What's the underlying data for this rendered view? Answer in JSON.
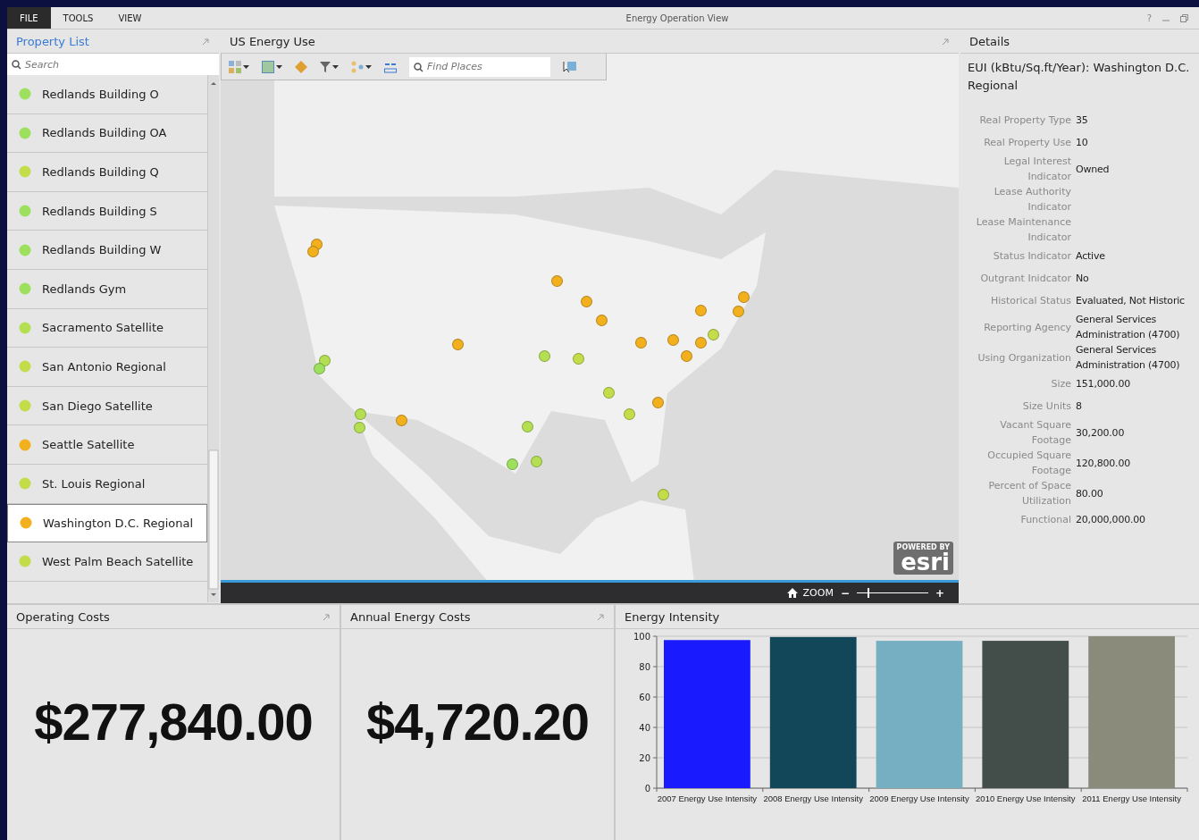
{
  "window": {
    "title": "Energy Operation View",
    "menu": [
      {
        "label": "FILE",
        "selected": true
      },
      {
        "label": "TOOLS",
        "selected": false
      },
      {
        "label": "VIEW",
        "selected": false
      }
    ],
    "help": "?"
  },
  "property_list": {
    "title": "Property List",
    "search": {
      "placeholder": "Search"
    },
    "items": [
      {
        "name": "Redlands Building O",
        "color": "#9de05e",
        "selected": false
      },
      {
        "name": "Redlands Building OA",
        "color": "#9de05e",
        "selected": false
      },
      {
        "name": "Redlands Building Q",
        "color": "#c2dc4a",
        "selected": false
      },
      {
        "name": "Redlands Building S",
        "color": "#9de05e",
        "selected": false
      },
      {
        "name": "Redlands Building W",
        "color": "#9de05e",
        "selected": false
      },
      {
        "name": "Redlands Gym",
        "color": "#9de05e",
        "selected": false
      },
      {
        "name": "Sacramento Satellite",
        "color": "#b4df52",
        "selected": false
      },
      {
        "name": "San Antonio Regional",
        "color": "#c2dc4a",
        "selected": false
      },
      {
        "name": "San Diego Satellite",
        "color": "#c2dc4a",
        "selected": false
      },
      {
        "name": "Seattle Satellite",
        "color": "#f2b01e",
        "selected": false
      },
      {
        "name": "St. Louis Regional",
        "color": "#c2dc4a",
        "selected": false
      },
      {
        "name": "Washington D.C. Regional",
        "color": "#f2b01e",
        "selected": true
      },
      {
        "name": "West Palm Beach Satellite",
        "color": "#c2dc4a",
        "selected": false
      }
    ]
  },
  "map": {
    "title": "US Energy Use",
    "find": {
      "placeholder": "Find Places"
    },
    "markers": [
      {
        "color": "#f2b01e"
      },
      {
        "color": "#f2b01e"
      },
      {
        "color": "#f2b01e"
      },
      {
        "color": "#f2b01e"
      },
      {
        "color": "#f2b01e"
      },
      {
        "color": "#f2b01e"
      },
      {
        "color": "#f2b01e"
      },
      {
        "color": "#f2b01e"
      },
      {
        "color": "#f2b01e"
      },
      {
        "color": "#f2b01e"
      },
      {
        "color": "#f2b01e"
      },
      {
        "color": "#f2b01e"
      },
      {
        "color": "#c2dc4a"
      },
      {
        "color": "#f2b01e"
      },
      {
        "color": "#b4df52"
      },
      {
        "color": "#c2dc4a"
      },
      {
        "color": "#b4df52"
      },
      {
        "color": "#9de05e"
      },
      {
        "color": "#c2dc4a"
      },
      {
        "color": "#f2b01e"
      },
      {
        "color": "#c2dc4a"
      },
      {
        "color": "#b4df52"
      },
      {
        "color": "#b4df52"
      },
      {
        "color": "#f2b01e"
      },
      {
        "color": "#b4df52"
      },
      {
        "color": "#9de05e"
      },
      {
        "color": "#b4df52"
      },
      {
        "color": "#c2dc4a"
      }
    ],
    "logo_caption": "POWERED BY",
    "logo": "esri",
    "zoom": {
      "label": "ZOOM",
      "minus": "−",
      "plus": "+",
      "level": 0.15
    }
  },
  "details": {
    "title": "Details",
    "heading": "EUI (kBtu/Sq.ft/Year): Washington D.C. Regional",
    "rows": [
      {
        "label": "Real Property Type",
        "value": "35"
      },
      {
        "label": "Real Property Use",
        "value": "10"
      },
      {
        "label": "Legal Interest Indicator",
        "value": "Owned"
      },
      {
        "label": "Lease Authority Indicator"
      },
      {
        "label": "Lease Maintenance Indicator"
      },
      {
        "label": "Status Indicator",
        "value": "Active"
      },
      {
        "label": "Outgrant Inidcator",
        "value": "No"
      },
      {
        "label": "Historical Status",
        "value": "Evaluated, Not Historic"
      },
      {
        "label": "Reporting Agency",
        "value": "General Services Administration (4700)"
      },
      {
        "label": "Using Organization",
        "value": "General Services Administration (4700)"
      },
      {
        "label": "Size",
        "value": "151,000.00"
      },
      {
        "label": "Size Units",
        "value": "8"
      },
      {
        "label": "Vacant Square Footage",
        "value": "30,200.00"
      },
      {
        "label": "Occupied Square Footage",
        "value": "120,800.00"
      },
      {
        "label": "Percent of Space Utilization",
        "value": "80.00"
      },
      {
        "label": "Functional",
        "value": "20,000,000.00"
      }
    ]
  },
  "operating_costs": {
    "title": "Operating Costs",
    "value": "$277,840.00"
  },
  "annual_energy_costs": {
    "title": "Annual Energy Costs",
    "value": "$4,720.20"
  },
  "energy_intensity": {
    "title": "Energy Intensity",
    "chart_data": {
      "type": "bar",
      "series": [
        {
          "name": "2007 Energy Use Intensity",
          "color": "#1a1aff",
          "values": [
            97.5
          ]
        },
        {
          "name": "2008 Energy Use Intensity",
          "color": "#12475a",
          "values": [
            99.5
          ]
        },
        {
          "name": "2009 Energy Use Intensity",
          "color": "#76aec2",
          "values": [
            97
          ]
        },
        {
          "name": "2010 Energy Use Intensity",
          "color": "#434d4a",
          "values": [
            97
          ]
        },
        {
          "name": "2011 Energy Use Intensity",
          "color": "#8b8b7b",
          "values": [
            100
          ]
        }
      ],
      "grid": true,
      "ylim": [
        0,
        100
      ],
      "yticks": [
        0,
        20,
        40,
        60,
        80,
        100
      ]
    }
  }
}
